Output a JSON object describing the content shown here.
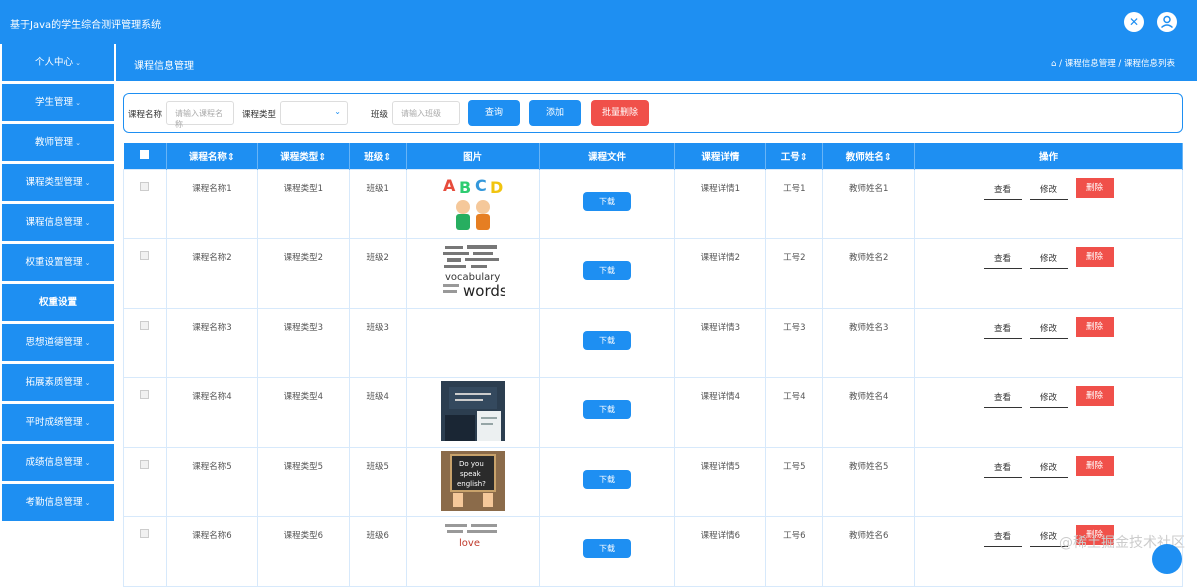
{
  "app": {
    "title": "基于Java的学生综合测评管理系统"
  },
  "topbar_icons": [
    "close-icon",
    "user-icon"
  ],
  "sidebar": {
    "items": [
      {
        "label": "个人中心"
      },
      {
        "label": "学生管理"
      },
      {
        "label": "教师管理"
      },
      {
        "label": "课程类型管理"
      },
      {
        "label": "课程信息管理"
      },
      {
        "label": "权重设置管理"
      },
      {
        "label": "权重设置"
      },
      {
        "label": "思想道德管理"
      },
      {
        "label": "拓展素质管理"
      },
      {
        "label": "平时成绩管理"
      },
      {
        "label": "成绩信息管理"
      },
      {
        "label": "考勤信息管理"
      }
    ]
  },
  "header": {
    "title": "课程信息管理",
    "breadcrumb": "⌂ / 课程信息管理 / 课程信息列表"
  },
  "search": {
    "course_name_label": "课程名称",
    "course_name_placeholder": "请输入课程名称",
    "course_type_label": "课程类型",
    "course_type_value": "",
    "class_label": "班级",
    "class_placeholder": "请输入班级",
    "query_button": "查询",
    "add_button": "添加",
    "batch_delete_button": "批量删除"
  },
  "table": {
    "columns": [
      "课程名称⇕",
      "课程类型⇕",
      "班级⇕",
      "图片",
      "课程文件",
      "课程详情",
      "工号⇕",
      "教师姓名⇕",
      "操作"
    ],
    "download_label": "下载",
    "view_label": "查看",
    "edit_label": "修改",
    "delete_label": "删除",
    "rows": [
      {
        "name": "课程名称1",
        "type": "课程类型1",
        "class": "班级1",
        "image": "abcd-kids",
        "detail": "课程详情1",
        "id": "工号1",
        "teacher": "教师姓名1"
      },
      {
        "name": "课程名称2",
        "type": "课程类型2",
        "class": "班级2",
        "image": "vocabulary-words",
        "detail": "课程详情2",
        "id": "工号2",
        "teacher": "教师姓名2"
      },
      {
        "name": "课程名称3",
        "type": "课程类型3",
        "class": "班级3",
        "image": "",
        "detail": "课程详情3",
        "id": "工号3",
        "teacher": "教师姓名3"
      },
      {
        "name": "课程名称4",
        "type": "课程类型4",
        "class": "班级4",
        "image": "classroom-teacher",
        "detail": "课程详情4",
        "id": "工号4",
        "teacher": "教师姓名4"
      },
      {
        "name": "课程名称5",
        "type": "课程类型5",
        "class": "班级5",
        "image": "do-you-speak-english",
        "detail": "课程详情5",
        "id": "工号5",
        "teacher": "教师姓名5"
      },
      {
        "name": "课程名称6",
        "type": "课程类型6",
        "class": "班级6",
        "image": "word-cloud",
        "detail": "课程详情6",
        "id": "工号6",
        "teacher": "教师姓名6"
      }
    ]
  },
  "thumb_text": {
    "abcd": [
      "A",
      "B",
      "C",
      "D"
    ],
    "vocab_line1": "vocabulary",
    "vocab_line2": "words",
    "speak_line1": "Do you",
    "speak_line2": "speak",
    "speak_line3": "english?",
    "cloud_word": "love"
  },
  "watermark": "@稀土掘金技术社区",
  "colors": {
    "primary": "#1e8ff2",
    "danger": "#f0504a"
  }
}
